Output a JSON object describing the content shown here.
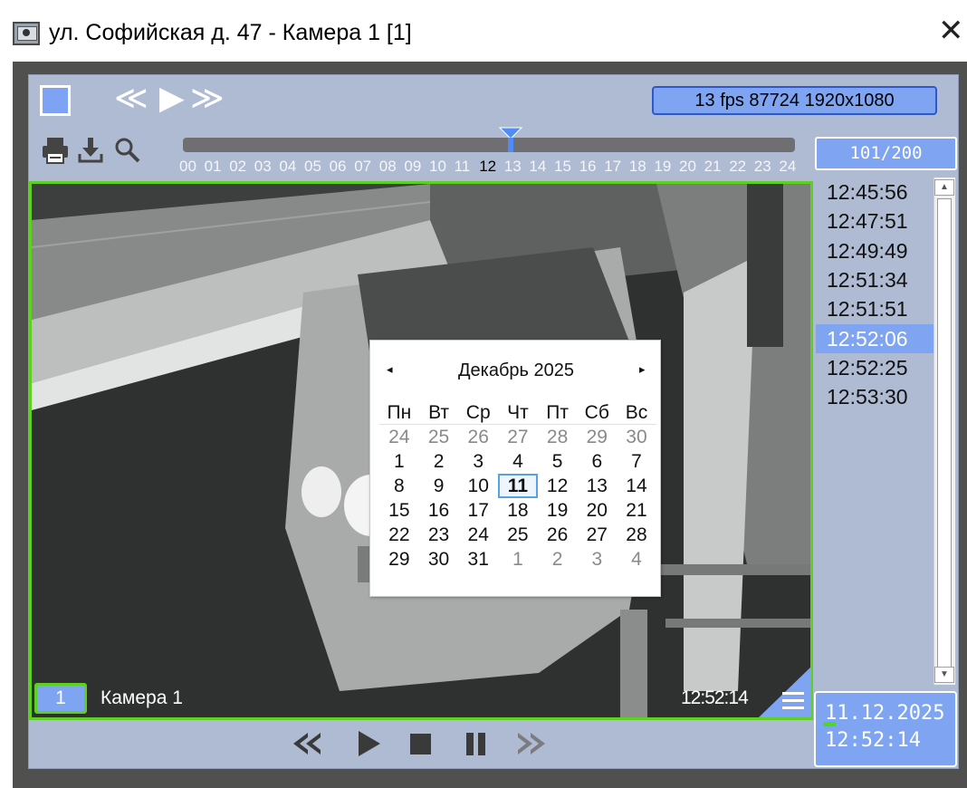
{
  "window": {
    "title": "ул. Софийская д. 47 - Камера 1 [1]",
    "close_glyph": "✕"
  },
  "toolbar": {
    "square_button_icon": "stop-square-icon",
    "rewind_glyph": "≪",
    "play_glyph": "▶",
    "forward_glyph": "≫",
    "stream_info": "13 fps  87724 1920x1080",
    "icons": [
      "print-icon",
      "download-icon",
      "search-icon"
    ]
  },
  "timeline": {
    "hours": [
      "00",
      "01",
      "02",
      "03",
      "04",
      "05",
      "06",
      "07",
      "08",
      "09",
      "10",
      "11",
      "12",
      "13",
      "14",
      "15",
      "16",
      "17",
      "18",
      "19",
      "20",
      "21",
      "22",
      "23",
      "24"
    ],
    "active_hour": "12",
    "counter": "101/200"
  },
  "video": {
    "camera_number": "1",
    "camera_name": "Камера 1",
    "timestamp": "12:52:14"
  },
  "calendar": {
    "prev_glyph": "◂",
    "next_glyph": "▸",
    "month_title": "Декабрь 2025",
    "weekdays": [
      "Пн",
      "Вт",
      "Ср",
      "Чт",
      "Пт",
      "Сб",
      "Вс"
    ],
    "weeks": [
      [
        "24",
        "25",
        "26",
        "27",
        "28",
        "29",
        "30"
      ],
      [
        "1",
        "2",
        "3",
        "4",
        "5",
        "6",
        "7"
      ],
      [
        "8",
        "9",
        "10",
        "11",
        "12",
        "13",
        "14"
      ],
      [
        "15",
        "16",
        "17",
        "18",
        "19",
        "20",
        "21"
      ],
      [
        "22",
        "23",
        "24",
        "25",
        "26",
        "27",
        "28"
      ],
      [
        "29",
        "30",
        "31",
        "1",
        "2",
        "3",
        "4"
      ]
    ],
    "selected_day": "11"
  },
  "time_list": {
    "items": [
      "12:45:56",
      "12:47:51",
      "12:49:49",
      "12:51:34",
      "12:51:51",
      "12:52:06",
      "12:52:25",
      "12:53:30"
    ],
    "selected": "12:52:06"
  },
  "datetime": {
    "date": "11.12.2025",
    "time": "12:52:14"
  },
  "playback": {
    "rewind_glyph": "≪",
    "forward_glyph": "≫"
  },
  "colors": {
    "accent": "#7ea4f2",
    "panel": "#aebbd2",
    "frame_green": "#5ed021",
    "dark_frame": "#50504e"
  }
}
